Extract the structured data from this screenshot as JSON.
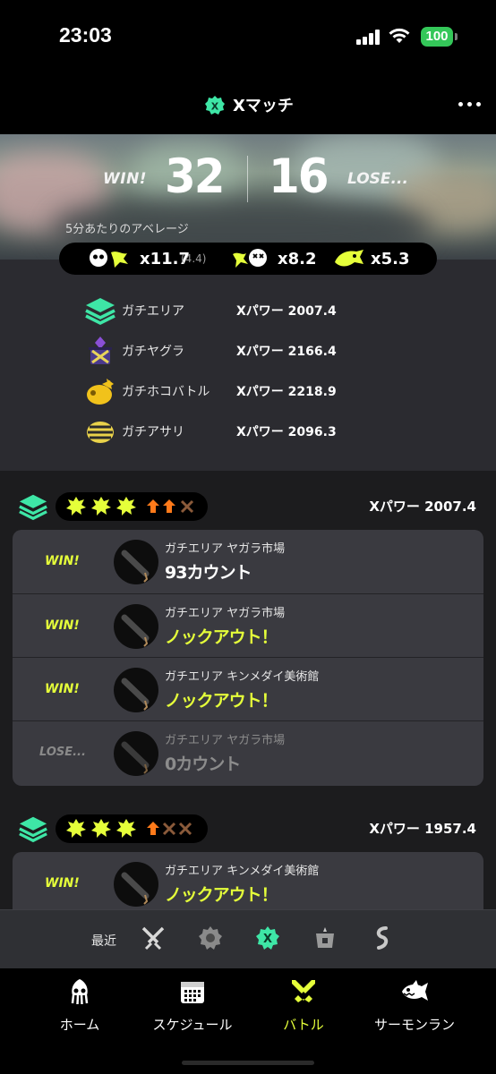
{
  "status": {
    "time": "23:03",
    "battery": "100"
  },
  "header": {
    "title": "Xマッチ",
    "icon": "x-match-icon",
    "menu_icon": "more-dots-icon"
  },
  "banner": {
    "win_label": "WIN!",
    "win_count": "32",
    "lose_count": "16",
    "lose_label": "LOSE...",
    "average_label": "5分あたりのアベレージ"
  },
  "stats": {
    "kill_assist": "x11.7",
    "assist": "(4.4)",
    "death": "x8.2",
    "special": "x5.3"
  },
  "modes": [
    {
      "name": "ガチエリア",
      "power": "Xパワー 2007.4",
      "icon": "splat-zones-icon"
    },
    {
      "name": "ガチヤグラ",
      "power": "Xパワー 2166.4",
      "icon": "tower-control-icon"
    },
    {
      "name": "ガチホコバトル",
      "power": "Xパワー 2218.9",
      "icon": "rainmaker-icon"
    },
    {
      "name": "ガチアサリ",
      "power": "Xパワー 2096.3",
      "icon": "clam-blitz-icon"
    }
  ],
  "groups": [
    {
      "power": "Xパワー 2007.4",
      "matches": [
        {
          "result": "WIN!",
          "meta": "ガチエリア ヤガラ市場",
          "score": "93カウント"
        },
        {
          "result": "WIN!",
          "meta": "ガチエリア ヤガラ市場",
          "score": "ノックアウト！"
        },
        {
          "result": "WIN!",
          "meta": "ガチエリア キンメダイ美術館",
          "score": "ノックアウト！"
        },
        {
          "result": "LOSE...",
          "meta": "ガチエリア ヤガラ市場",
          "score": "0カウント"
        }
      ]
    },
    {
      "power": "Xパワー 1957.4",
      "matches": [
        {
          "result": "WIN!",
          "meta": "ガチエリア キンメダイ美術館",
          "score": "ノックアウト！"
        }
      ]
    }
  ],
  "filter": {
    "label": "最近",
    "icons": [
      "battle-filter-icon",
      "regular-filter-icon",
      "x-match-filter-icon",
      "private-filter-icon",
      "challenge-filter-icon"
    ]
  },
  "tabs": [
    {
      "label": "ホーム",
      "icon": "squid-home-icon"
    },
    {
      "label": "スケジュール",
      "icon": "calendar-icon"
    },
    {
      "label": "バトル",
      "icon": "battle-icon"
    },
    {
      "label": "サーモンラン",
      "icon": "salmon-icon"
    }
  ],
  "colors": {
    "accent": "#e5ff3a",
    "x_green": "#3ee6a6",
    "orange": "#ff7a1a"
  }
}
